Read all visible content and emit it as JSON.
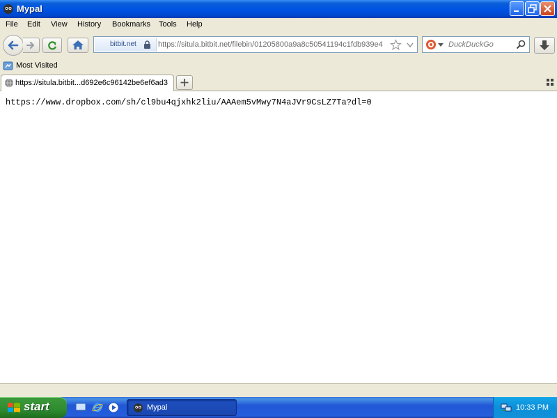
{
  "window": {
    "title": "Mypal"
  },
  "menu": [
    "File",
    "Edit",
    "View",
    "History",
    "Bookmarks",
    "Tools",
    "Help"
  ],
  "urlbar": {
    "identity": "bitbit.net",
    "url": "https://situla.bitbit.net/filebin/01205800a9a8c50541194c1fdb939e4"
  },
  "search": {
    "placeholder": "DuckDuckGo"
  },
  "bookmarks": {
    "most_visited": "Most Visited"
  },
  "tab": {
    "label": "https://situla.bitbit...d692e6c96142be6ef6ad3"
  },
  "content": {
    "text": "https://www.dropbox.com/sh/cl9bu4qjxhk2liu/AAAem5vMwy7N4aJVr9CsLZ7Ta?dl=0"
  },
  "taskbar": {
    "start": "start",
    "task": "Mypal",
    "clock": "10:33 PM"
  }
}
